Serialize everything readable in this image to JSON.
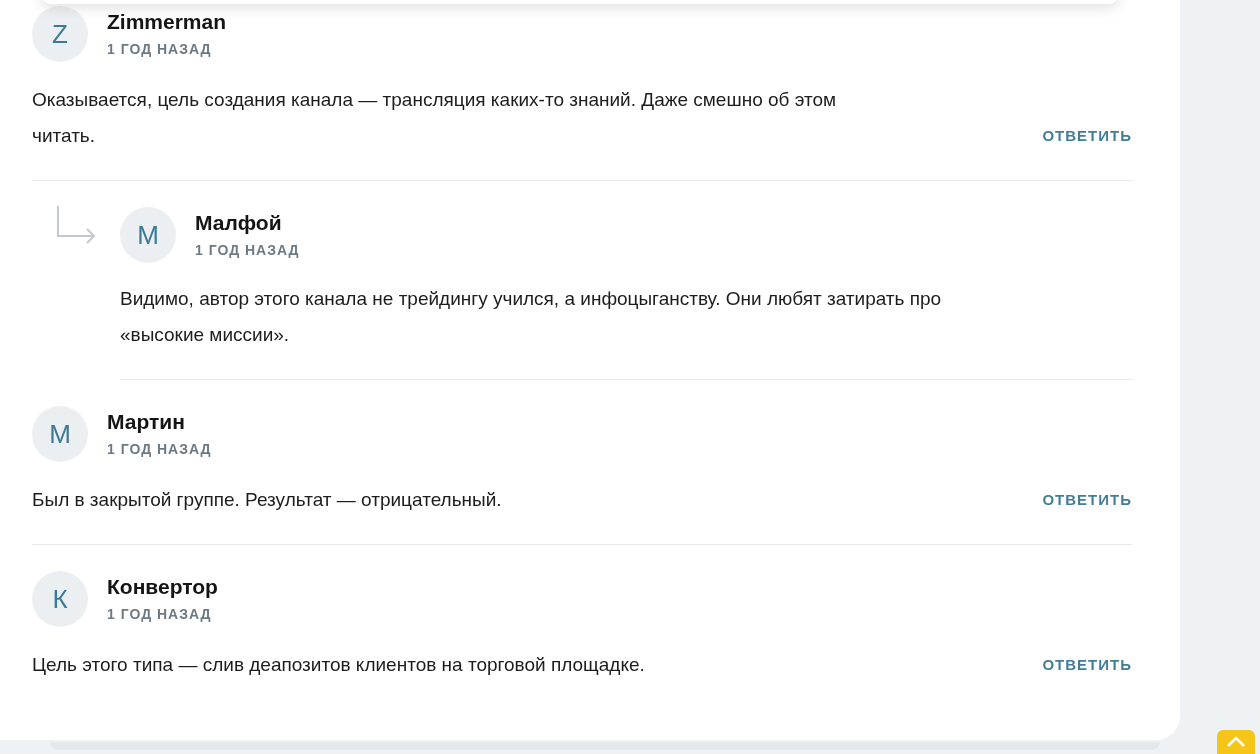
{
  "comments": [
    {
      "initial": "Z",
      "author": "Zimmerman",
      "time": "1 ГОД НАЗАД",
      "text": "Оказывается, цель создания канала — трансляция каких-то знаний. Даже смешно об этом читать.",
      "reply_label": "ОТВЕТИТЬ",
      "children": [
        {
          "initial": "М",
          "author": "Малфой",
          "time": "1 ГОД НАЗАД",
          "text": "Видимо, автор этого канала не трейдингу учился, а инфоцыганству. Они любят затирать про «высокие миссии»."
        }
      ]
    },
    {
      "initial": "М",
      "author": "Мартин",
      "time": "1 ГОД НАЗАД",
      "text": "Был в закрытой группе. Результат — отрицательный.",
      "reply_label": "ОТВЕТИТЬ"
    },
    {
      "initial": "К",
      "author": "Конвертор",
      "time": "1 ГОД НАЗАД",
      "text": "Цель этого типа — слив деапозитов клиентов на торговой площадке.",
      "reply_label": "ОТВЕТИТЬ"
    }
  ]
}
